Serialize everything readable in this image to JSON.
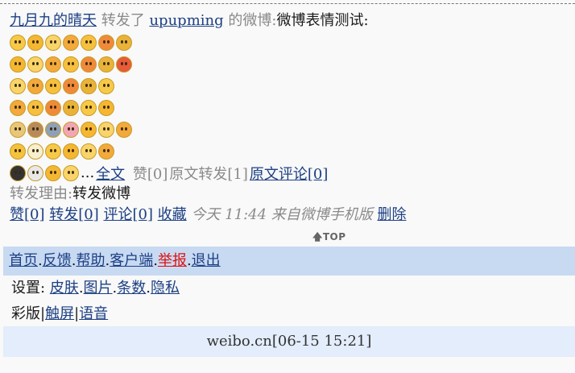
{
  "post": {
    "author": "九月九的晴天",
    "action": "转发了",
    "original_author": "upupming",
    "of_weibo": "的微博:",
    "content": "微博表情测试:",
    "emoji_rows": [
      [
        "smile",
        "grin",
        "kiss-wink",
        "hug",
        "shy",
        "laugh",
        "rofl"
      ],
      [
        "tongue",
        "surprised",
        "smirk",
        "sweat",
        "yawn",
        "tease",
        "angry"
      ],
      [
        "sad",
        "worried",
        "pout",
        "crying-sweat",
        "cry",
        "sob-face"
      ],
      [
        "cool-squint",
        "frustrated",
        "blush-kiss",
        "hearts",
        "heart-eyes",
        "scared"
      ],
      [
        "doge",
        "cat",
        "husky",
        "pig",
        "grin-teeth",
        "smug",
        "thinking"
      ],
      [
        "sunglasses",
        "glasses",
        "meh",
        "confused",
        "sweat-smile",
        "dizzy"
      ],
      [
        "black-face",
        "skull",
        "hmm",
        "shocked"
      ]
    ],
    "ellipsis": "...",
    "full_text_link": "全文",
    "like_count_text": "赞[0]",
    "original_repost_text": "原文转发[1]",
    "original_comment_link": "原文评论[0]",
    "reason_label": "转发理由:",
    "reason": "转发微博",
    "actions": {
      "like": "赞[0]",
      "repost": "转发[0]",
      "comment": "评论[0]",
      "favorite": "收藏",
      "timestamp": "今天 11:44 来自微博手机版",
      "delete": "删除"
    }
  },
  "top_label": "TOP",
  "nav": {
    "items": [
      "首页",
      "反馈",
      "帮助",
      "客户端",
      "举报",
      "退出"
    ],
    "separator": "."
  },
  "settings": {
    "label": "设置:",
    "items": [
      "皮肤",
      "图片",
      "条数",
      "隐私"
    ]
  },
  "modes": {
    "current": "彩版",
    "items": [
      "触屏",
      "语音"
    ],
    "separator": "|"
  },
  "footer": {
    "text": "weibo.cn[06-15 15:21]"
  },
  "colors": {
    "link": "#1d3f84",
    "nav_bg": "#c7daf2",
    "footer_bg": "#e3edfb",
    "report": "#e01010",
    "grey": "#8a8a8a"
  }
}
